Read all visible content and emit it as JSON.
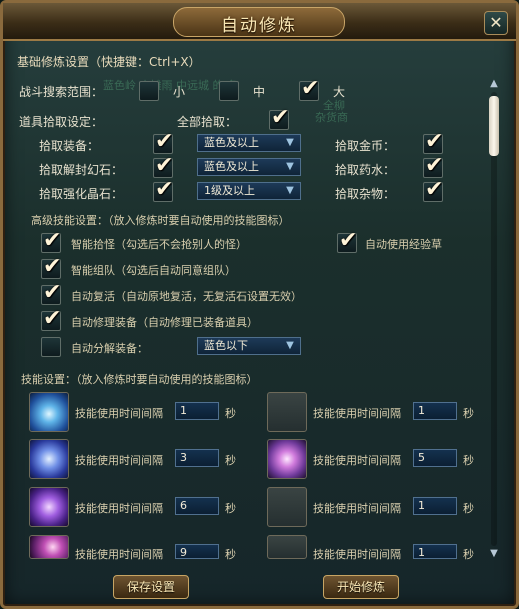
{
  "window": {
    "title": "自动修炼",
    "close_glyph": "✕"
  },
  "header_section": {
    "title": "基础修炼设置（快捷键：Ctrl+X）"
  },
  "search_range": {
    "label": "战斗搜索范围：",
    "options": [
      {
        "label": "小",
        "checked": false
      },
      {
        "label": "中",
        "checked": false
      },
      {
        "label": "大",
        "checked": true
      }
    ]
  },
  "pickup": {
    "label": "道具拾取设定：",
    "all_label": "全部拾取：",
    "all_checked": true,
    "left_rows": [
      {
        "label": "拾取装备：",
        "checked": true,
        "dropdown": "蓝色及以上"
      },
      {
        "label": "拾取解封幻石：",
        "checked": true,
        "dropdown": "蓝色及以上"
      },
      {
        "label": "拾取强化晶石：",
        "checked": true,
        "dropdown": "1级及以上"
      }
    ],
    "right_rows": [
      {
        "label": "拾取金币：",
        "checked": true
      },
      {
        "label": "拾取药水：",
        "checked": true
      },
      {
        "label": "拾取杂物：",
        "checked": true
      }
    ]
  },
  "advanced": {
    "title": "高级技能设置：（放入修炼时要自动使用的技能图标）",
    "rows": [
      {
        "label": "智能拾怪（勾选后不会抢别人的怪）",
        "checked": true
      },
      {
        "label": "智能组队（勾选后自动同意组队）",
        "checked": true
      },
      {
        "label": "自动复活（自动原地复活，无复活石设置无效）",
        "checked": true
      },
      {
        "label": "自动修理装备（自动修理已装备道具）",
        "checked": true
      },
      {
        "label": "自动分解装备：",
        "checked": false,
        "dropdown": "蓝色以下"
      }
    ],
    "exp_grass": {
      "label": "自动使用经验草",
      "checked": true
    }
  },
  "skills": {
    "title": "技能设置：（放入修炼时要自动使用的技能图标）",
    "interval_label": "技能使用时间间隔",
    "unit": "秒",
    "left": [
      {
        "icon": "ice-wave-skill-icon",
        "value": "1"
      },
      {
        "icon": "frost-storm-skill-icon",
        "value": "3"
      },
      {
        "icon": "shadow-slash-skill-icon",
        "value": "6"
      },
      {
        "icon": "magic-burst-skill-icon",
        "value": "9"
      }
    ],
    "right": [
      {
        "icon": "empty-slot",
        "value": "1"
      },
      {
        "icon": "meditation-skill-icon",
        "value": "5"
      },
      {
        "icon": "empty-slot",
        "value": "1"
      },
      {
        "icon": "empty-slot",
        "value": "1"
      }
    ]
  },
  "buttons": {
    "save": "保存设置",
    "start": "开始修炼"
  },
  "background": {
    "text_line": "蓝色岭  小摊雨     中远城  的 备",
    "label_top": "全柳",
    "label_bottom": "杂货商"
  },
  "colors": {
    "frame": "#8a6a3d",
    "panel": "#1b2f2c",
    "title_text": "#fbe9b6",
    "dropdown_bg": "#1d3a58"
  }
}
